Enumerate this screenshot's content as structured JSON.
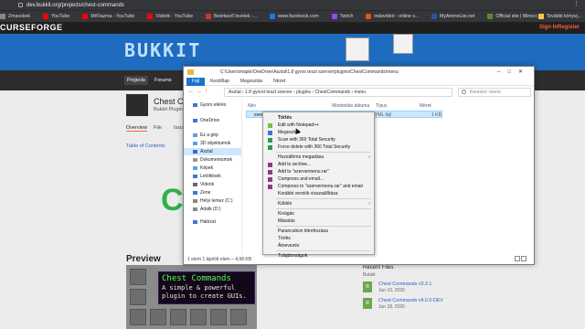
{
  "browser": {
    "url": "dev.bukkit.org/projects/chest-commands",
    "bookmarks": [
      {
        "label": "Zmaxxbok",
        "color": "#888888"
      },
      {
        "label": "YouTube",
        "color": "#ff0000"
      },
      {
        "label": "MrFiazma - YouTube",
        "color": "#ff0000"
      },
      {
        "label": "Videók - YouTube",
        "color": "#ff0000"
      },
      {
        "label": "Beérkező levelek -...",
        "color": "#d93025"
      },
      {
        "label": "www.facebook.com",
        "color": "#1877f2"
      },
      {
        "label": "Twitch",
        "color": "#9146ff"
      },
      {
        "label": "indavideó - online v...",
        "color": "#e94e1b"
      },
      {
        "label": "MyAnimeList.net",
        "color": "#2e51a2"
      },
      {
        "label": "Official site | Minecr...",
        "color": "#5a8d2c"
      }
    ],
    "other_bookmarks": "További könyvj..."
  },
  "curseforge": {
    "logo": "CURSEFORGE",
    "signin": "Sign In",
    "register": "Register"
  },
  "bukkit": {
    "banner_title": "BUKKIT",
    "nav": [
      "Projects",
      "Forums"
    ]
  },
  "project": {
    "title": "Chest Comm",
    "subtitle": "Bukkit Plugins",
    "tabs": [
      "Overview",
      "File",
      "Issue"
    ],
    "toc": "Table of Contents",
    "big_text": "CC",
    "preview_label": "Preview",
    "tooltip_title": "Chest Commands",
    "tooltip_line1": "A simple & powerful",
    "tooltip_line2": "plugin to create GUIs."
  },
  "recent_files": {
    "title": "Recent Files",
    "subtitle": "Bukkit",
    "files": [
      {
        "badge": "R",
        "name": "Chest Commands v3.3.1",
        "date": "Jun 10, 2020"
      },
      {
        "badge": "R",
        "name": "Chest Commands v4.0.0-DEV",
        "date": "Jun 18, 2020"
      }
    ]
  },
  "explorer": {
    "title_path": "C:\\Users\\maple\\OneDrive\\Asztal\\1.8 gyors teszt szerver\\plugins\\ChestCommands\\menu",
    "ribbon": [
      "Fájl",
      "Kezdőlap",
      "Megosztás",
      "Nézet"
    ],
    "breadcrumb": "Asztal  ›  1.8 gyorst teszt szerver  ›  plugins  ›  ChestCommands  ›  menu",
    "search_placeholder": "Keresés: menu",
    "sidebar": [
      {
        "label": "Gyors elérés",
        "color": "#3b78d8"
      },
      {
        "label": "OneDrive",
        "color": "#3b78d8"
      },
      {
        "label": "Ez a gép",
        "color": "#5aa3e8"
      },
      {
        "label": "3D objektumok",
        "color": "#5aa3e8"
      },
      {
        "label": "Asztal",
        "color": "#2f72c4"
      },
      {
        "label": "Dokumentumok",
        "color": "#999999"
      },
      {
        "label": "Képek",
        "color": "#5aa3e8"
      },
      {
        "label": "Letöltések",
        "color": "#3b78d8"
      },
      {
        "label": "Videók",
        "color": "#666666"
      },
      {
        "label": "Zene",
        "color": "#3b78d8"
      },
      {
        "label": "Helyi lemez (C:)",
        "color": "#888888"
      },
      {
        "label": "Adatk (D:)",
        "color": "#888888"
      },
      {
        "label": "Hálózat",
        "color": "#3b78d8"
      }
    ],
    "columns": [
      "Név",
      "Módosítás dátuma",
      "Típus",
      "Méret"
    ],
    "file": {
      "name": "exemenu.yml",
      "type": "YML fájl",
      "size": "1 KB"
    },
    "status": "1 elem     1 kijelölt elem – 4,98 KB"
  },
  "context_menu": {
    "items": [
      {
        "label": "Törlés",
        "bold": true,
        "icon": "",
        "arrow": false
      },
      {
        "label": "Edit with Notepad++",
        "icon": "#7dbb3c",
        "arrow": false
      },
      {
        "label": "Megosztás",
        "icon": "#3b78d8",
        "arrow": false
      },
      {
        "label": "Scan with 360 Total Security",
        "icon": "#2a9d4a",
        "arrow": false
      },
      {
        "label": "Force delete with 360 Total Security",
        "icon": "#2a9d4a",
        "arrow": false
      },
      {
        "sep": true
      },
      {
        "label": "Hozzáférés megadása",
        "icon": "",
        "arrow": true
      },
      {
        "label": "Add to archive...",
        "icon": "#8e3a8e",
        "arrow": false
      },
      {
        "label": "Add to \"szervermenu.rar\"",
        "icon": "#8e3a8e",
        "arrow": false
      },
      {
        "label": "Compress and email...",
        "icon": "#8e3a8e",
        "arrow": false
      },
      {
        "label": "Compress to \"szervermenu.rar\" and email",
        "icon": "#8e3a8e",
        "arrow": false
      },
      {
        "label": "Korábbi verziók visszaállítása",
        "icon": "",
        "arrow": false
      },
      {
        "sep": true
      },
      {
        "label": "Küldés",
        "icon": "",
        "arrow": true
      },
      {
        "sep": true
      },
      {
        "label": "Kivágás",
        "icon": "",
        "arrow": false
      },
      {
        "label": "Másolás",
        "icon": "",
        "arrow": false
      },
      {
        "sep": true
      },
      {
        "label": "Parancsikon létrehozása",
        "icon": "",
        "arrow": false
      },
      {
        "label": "Törlés",
        "icon": "",
        "arrow": false
      },
      {
        "label": "Átnevezés",
        "icon": "",
        "arrow": false
      },
      {
        "sep": true
      },
      {
        "label": "Tulajdonságok",
        "icon": "",
        "arrow": false
      }
    ]
  }
}
